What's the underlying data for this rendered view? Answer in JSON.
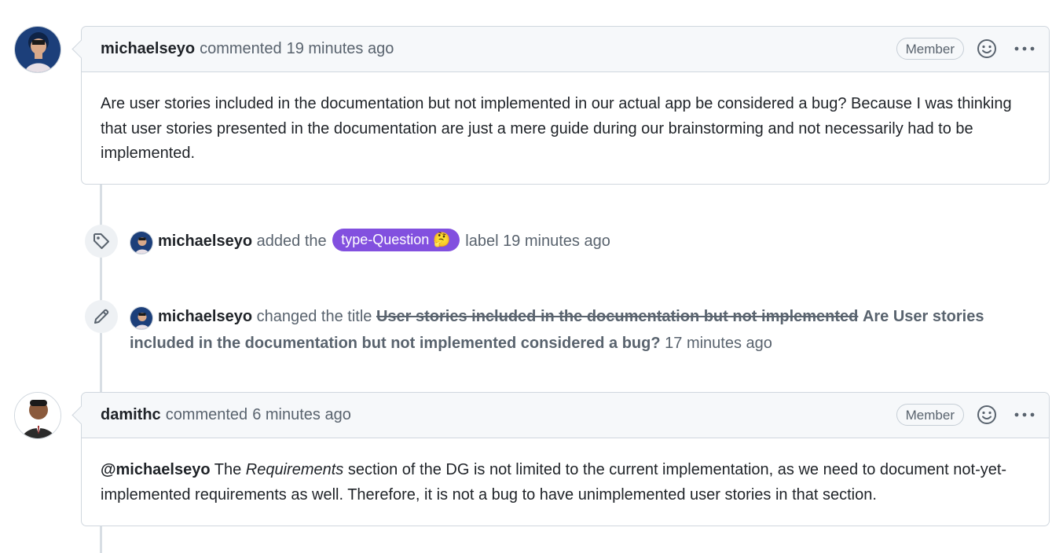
{
  "comments": [
    {
      "author": "michaelseyo",
      "action": "commented",
      "time": "19 minutes ago",
      "role": "Member",
      "body": "Are user stories included in the documentation but not implemented in our actual app be considered a bug? Because I was thinking that user stories presented in the documentation are just a mere guide during our brainstorming and not necessarily had to be implemented."
    },
    {
      "author": "damithc",
      "action": "commented",
      "time": "6 minutes ago",
      "role": "Member",
      "body_mention": "@michaelseyo",
      "body_pre": " The ",
      "body_em": "Requirements",
      "body_post": " section of the DG is not limited to the current implementation, as we need to document not-yet-implemented requirements as well. Therefore, it is not a bug to have unimplemented user stories in that section."
    }
  ],
  "events": {
    "label_event": {
      "actor": "michaelseyo",
      "pre": "added the",
      "label": "type-Question",
      "label_emoji": "🤔",
      "label_color": "#8250df",
      "post": "label 19 minutes ago",
      "icon": "tag-icon"
    },
    "rename_event": {
      "actor": "michaelseyo",
      "pre": "changed the title",
      "old_title": "User stories included in the documentation but not implemented",
      "new_title": "Are User stories included in the documentation but not implemented considered a bug?",
      "time": "17 minutes ago",
      "icon": "pencil-icon"
    }
  }
}
